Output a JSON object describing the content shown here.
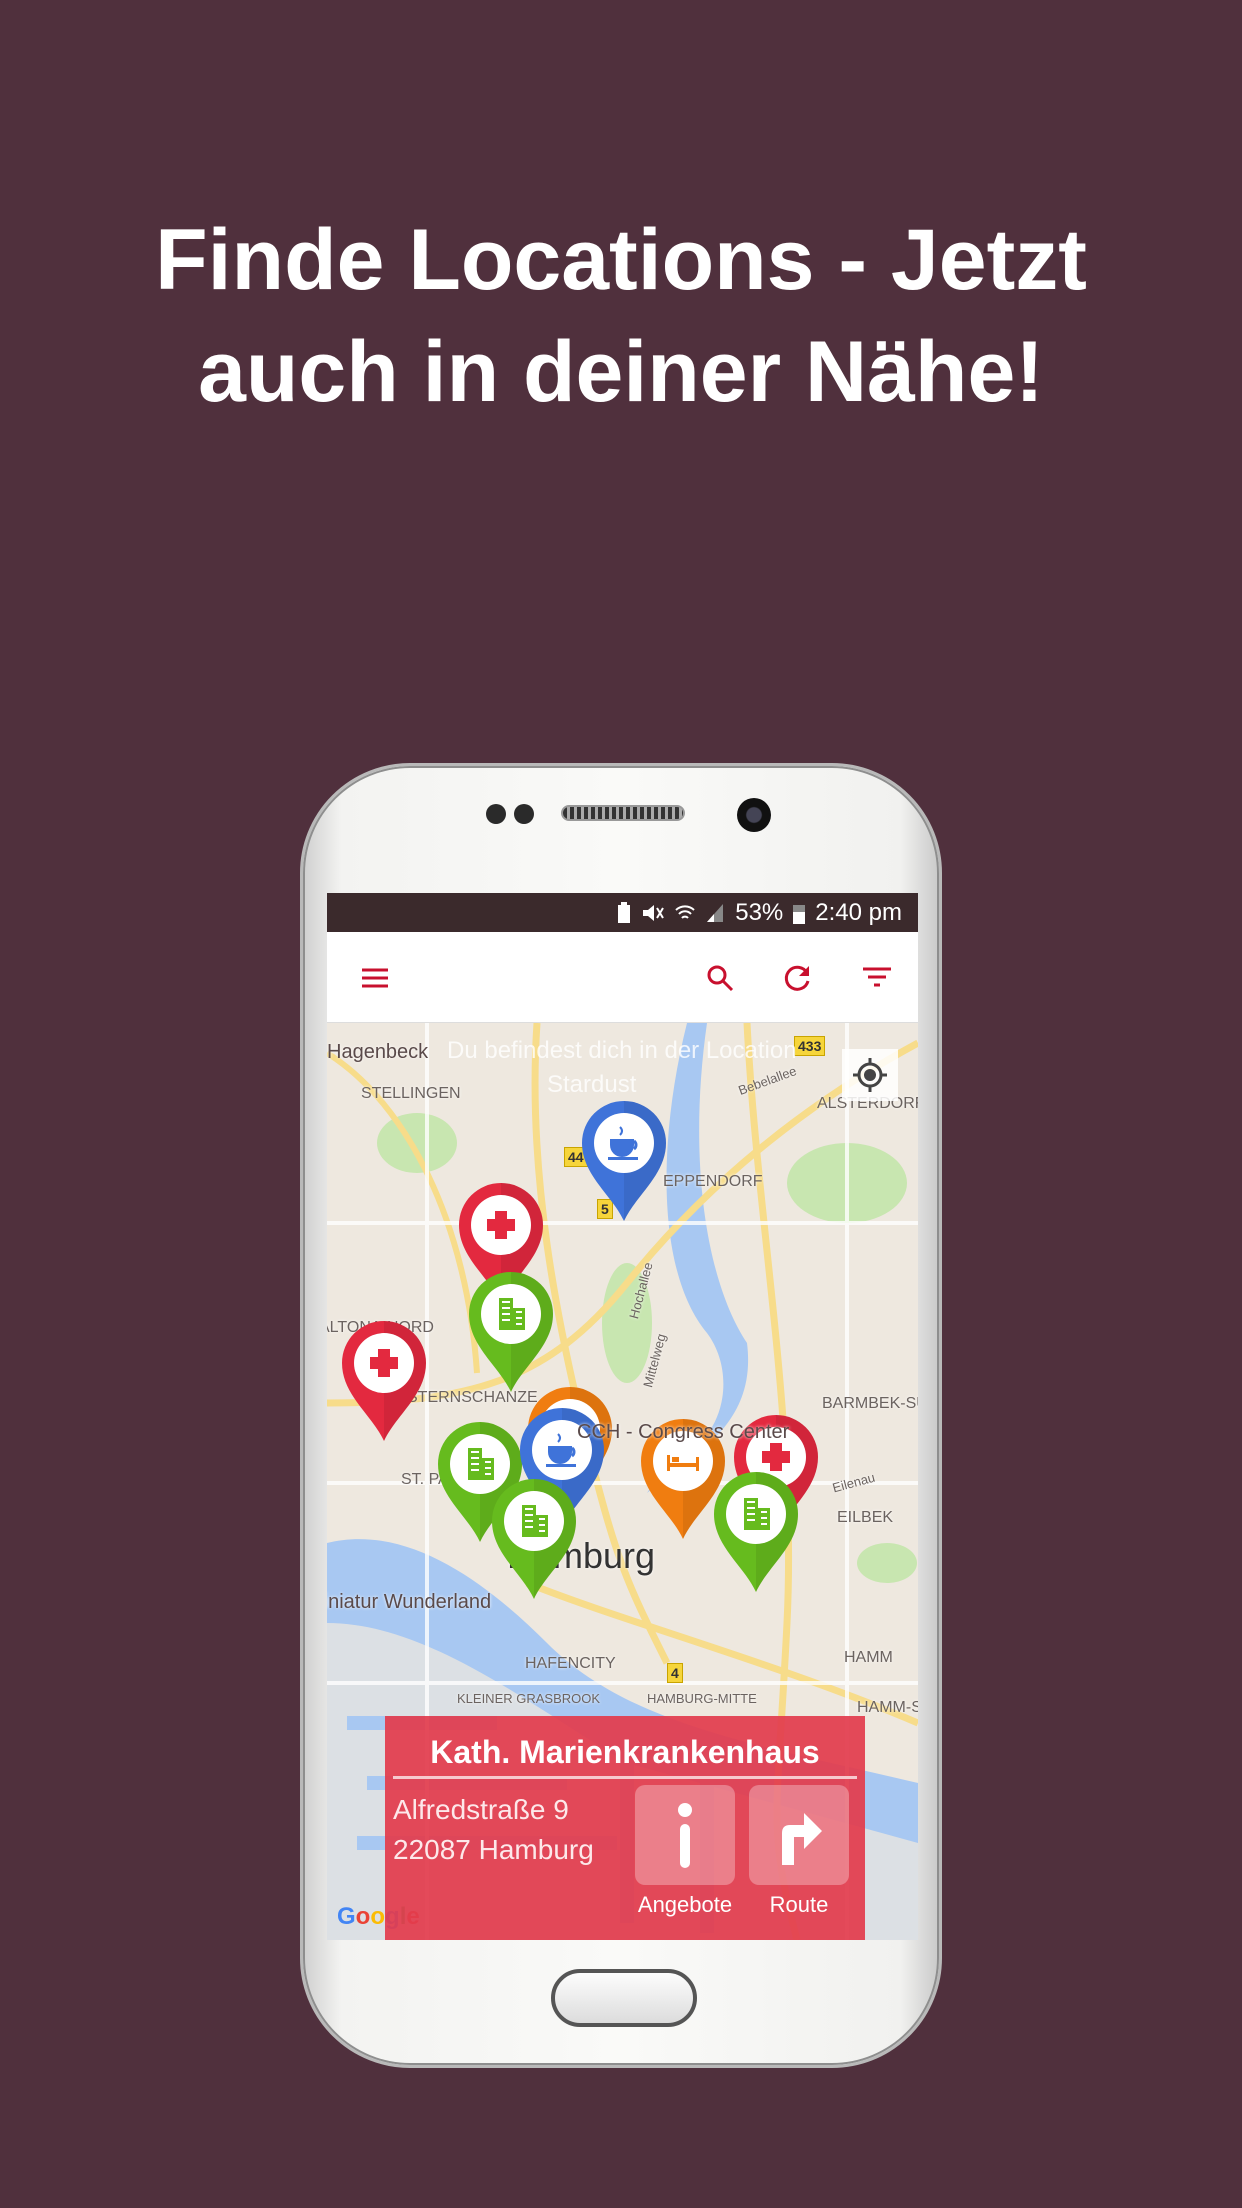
{
  "headline": {
    "line1": "Finde Locations - Jetzt",
    "line2": "auch in deiner Nähe!"
  },
  "colors": {
    "background": "#50303d",
    "accent": "#c8102e",
    "card": "#e23c4e",
    "pin_red": "#e3293f",
    "pin_green": "#66bb1e",
    "pin_blue": "#3f73d9",
    "pin_orange": "#f07d10"
  },
  "status_bar": {
    "battery": "53%",
    "time": "2:40 pm",
    "icons": [
      "battery-saver-icon",
      "mute-icon",
      "wifi-icon",
      "signal-icon",
      "battery-icon"
    ]
  },
  "toolbar": {
    "icons": [
      "menu-icon",
      "search-icon",
      "refresh-icon",
      "filter-icon"
    ]
  },
  "map": {
    "overlay_line1": "Du befindest dich in der Location",
    "overlay_line2": "Stardust",
    "labels": [
      "Hagenbeck",
      "STELLINGEN",
      "ALSTERDORF",
      "EPPENDORF",
      "ALTONA-NORD",
      "STERNSCHANZE",
      "BARMBEK-SÜD",
      "CCH - Congress Center",
      "ST. PAULI",
      "EILBEK",
      "Hamburg",
      "Miniatur Wunderland",
      "HAFENCITY",
      "HAMM",
      "Hochallee",
      "Mittelweg",
      "Eilenau",
      "Bebelallee",
      "KLEINER GRASBROOK",
      "HAMBURG-MITTE",
      "HAMM-SÜD"
    ],
    "shields": [
      "433",
      "44",
      "5",
      "4"
    ],
    "google": "Google",
    "pins": [
      {
        "type": "cafe",
        "color": "blue"
      },
      {
        "type": "hospital",
        "color": "red"
      },
      {
        "type": "company",
        "color": "green"
      },
      {
        "type": "hospital",
        "color": "red"
      },
      {
        "type": "hotel",
        "color": "orange"
      },
      {
        "type": "company",
        "color": "green"
      },
      {
        "type": "cafe",
        "color": "blue"
      },
      {
        "type": "company",
        "color": "green"
      },
      {
        "type": "hotel",
        "color": "orange"
      },
      {
        "type": "hospital",
        "color": "red"
      },
      {
        "type": "company",
        "color": "green"
      }
    ]
  },
  "card": {
    "title": "Kath. Marienkrankenhaus",
    "street": "Alfredstraße 9",
    "city": "22087 Hamburg",
    "offers_label": "Angebote",
    "route_label": "Route"
  }
}
